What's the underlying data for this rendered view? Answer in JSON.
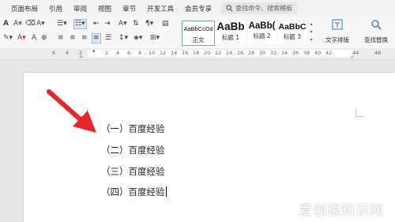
{
  "menu": {
    "items": [
      "页面布局",
      "引用",
      "审阅",
      "视图",
      "章节",
      "开发工具",
      "会员专享"
    ],
    "search_placeholder": "查找命令、搜索模板"
  },
  "ribbon": {
    "styles": [
      {
        "sample": "AaBbCcDd",
        "label": "正文"
      },
      {
        "sample": "AaBb",
        "label": "标题 1"
      },
      {
        "sample": "AaBb(",
        "label": "标题 2"
      },
      {
        "sample": "AaBbC",
        "label": "标题 3"
      }
    ],
    "text_layout_label": "文字排版",
    "find_replace_label": "查找替换"
  },
  "ruler": {
    "left_numbers": [
      "6",
      "4",
      "2"
    ],
    "right_numbers": [
      "2",
      "4",
      "6",
      "8",
      "10",
      "12",
      "14",
      "16",
      "18",
      "20",
      "22",
      "24",
      "26",
      "28",
      "30",
      "32",
      "34",
      "36",
      "38",
      "40",
      "42",
      "44",
      "46"
    ]
  },
  "document": {
    "lines": [
      "（一）百度经验",
      "（二）百度经验",
      "（三）百度经验",
      "（四）百度经验"
    ]
  },
  "watermark": "爱创根知识网",
  "colors": {
    "arrow": "#e8262a",
    "menubar": "#f3f3f3",
    "canvas": "#e8e8e8"
  }
}
